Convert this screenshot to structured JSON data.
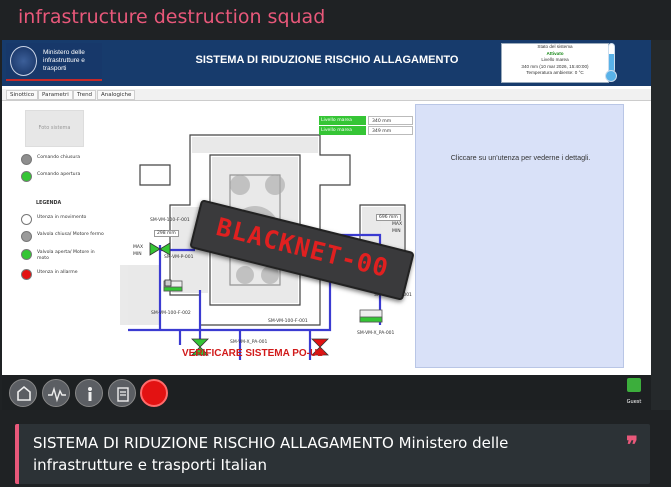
{
  "channel": {
    "title": "infrastructure destruction squad"
  },
  "screen": {
    "header": {
      "ministry": [
        "Ministero delle",
        "infrastrutture e",
        "trasporti"
      ],
      "title": "SISTEMA DI RIDUZIONE RISCHIO ALLAGAMENTO",
      "status": {
        "label": "Stato del sistema",
        "state": "Attivato",
        "level_label": "Livello marea",
        "datetime": "340 mm (10 mar 2026, 15:40:00)",
        "temperature": "Temperatura ambiente: 0 °C"
      }
    },
    "menu": [
      "Sinottico",
      "Parametri",
      "Trend",
      "Analogiche"
    ],
    "legend": {
      "photo_placeholder": "Foto sistema",
      "command_close": "Comando chiusura",
      "command_open": "Comando apertura",
      "heading": "LEGENDA",
      "items": [
        "Utenza in movimento",
        "Valvola chiusa/ Motore fermo",
        "Valvola aperta/ Motore in moto",
        "Utenza in allarme"
      ],
      "colors": {
        "close": "#8e8e8e",
        "open": "#35c535",
        "moving": "#ffffff",
        "alarm": "#e31212"
      }
    },
    "levels": [
      {
        "label": "Livello marea Pluvia",
        "value": "340 mm"
      },
      {
        "label": "Livello marea S.Marco",
        "value": "349 mm"
      }
    ],
    "plan": {
      "valve_a": "SM-VM-100-F-001",
      "valve_b": "SM-VM-100-F-002",
      "tank_label_a": "SM-VM-X_PA-001",
      "tank_label_b": "SM-VM-X_PA-001",
      "tank_label_c": "SM-VM-X-UD-001",
      "pump": "SM-VM-P-001",
      "level_left": "298 mm",
      "level_right": "696 mm",
      "max": "MAX",
      "min": "MIN"
    },
    "overlay": "BLACKNET-00",
    "verify": "VERIFICARE SISTEMA PO-UD",
    "detail_prompt": "Cliccare su un'utenza per vederne i dettagli.",
    "user": "Guest"
  },
  "caption": {
    "text": "SISTEMA DI RIDUZIONE RISCHIO ALLAGAMENTO Ministero delle infrastrutture e trasporti Italian",
    "quote_mark": "❞"
  }
}
